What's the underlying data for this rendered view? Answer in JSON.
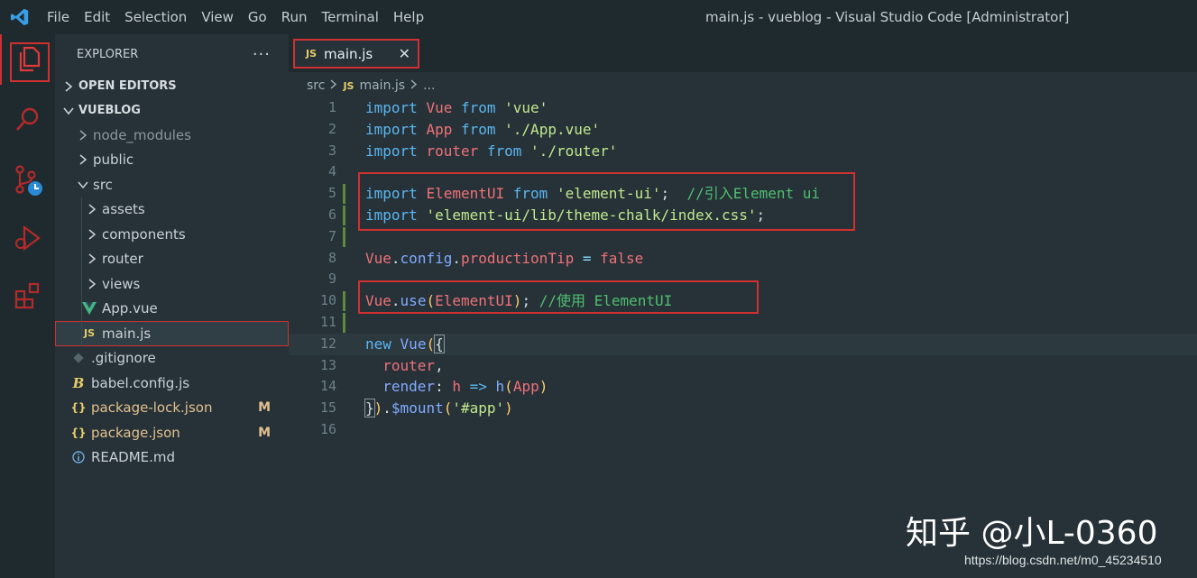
{
  "titlebar": {
    "menu": [
      "File",
      "Edit",
      "Selection",
      "View",
      "Go",
      "Run",
      "Terminal",
      "Help"
    ],
    "title": "main.js - vueblog - Visual Studio Code [Administrator]"
  },
  "activity": {
    "items": [
      "explorer-icon",
      "search-icon",
      "source-control-icon",
      "run-debug-icon",
      "extensions-icon"
    ]
  },
  "explorer": {
    "header": "EXPLORER",
    "more": "···",
    "open_editors": "OPEN EDITORS",
    "project": "VUEBLOG",
    "tree": [
      {
        "label": "node_modules",
        "type": "folder"
      },
      {
        "label": "public",
        "type": "folder"
      },
      {
        "label": "src",
        "type": "folder-open"
      },
      {
        "label": "assets",
        "type": "folder"
      },
      {
        "label": "components",
        "type": "folder"
      },
      {
        "label": "router",
        "type": "folder"
      },
      {
        "label": "views",
        "type": "folder"
      },
      {
        "label": "App.vue",
        "type": "vue"
      },
      {
        "label": "main.js",
        "type": "js"
      },
      {
        "label": ".gitignore",
        "type": "git"
      },
      {
        "label": "babel.config.js",
        "type": "babel"
      },
      {
        "label": "package-lock.json",
        "type": "json",
        "badge": "M"
      },
      {
        "label": "package.json",
        "type": "json",
        "badge": "M"
      },
      {
        "label": "README.md",
        "type": "info"
      }
    ]
  },
  "tabs": [
    {
      "label": "main.js",
      "badge": "JS",
      "close": "✕"
    }
  ],
  "breadcrumb": {
    "folder": "src",
    "badge": "JS",
    "file": "main.js",
    "more": "..."
  },
  "editor": {
    "lines": [
      "1",
      "2",
      "3",
      "4",
      "5",
      "6",
      "7",
      "8",
      "9",
      "10",
      "11",
      "12",
      "13",
      "14",
      "15",
      "16"
    ]
  },
  "colors": {
    "accent_red": "#d0302f",
    "keyword": "#5bb6f0",
    "string": "#c3e88d",
    "comment": "#4fbf6f"
  },
  "watermark": {
    "big": "知乎 @小L-0360",
    "url": "https://blog.csdn.net/m0_45234510"
  }
}
